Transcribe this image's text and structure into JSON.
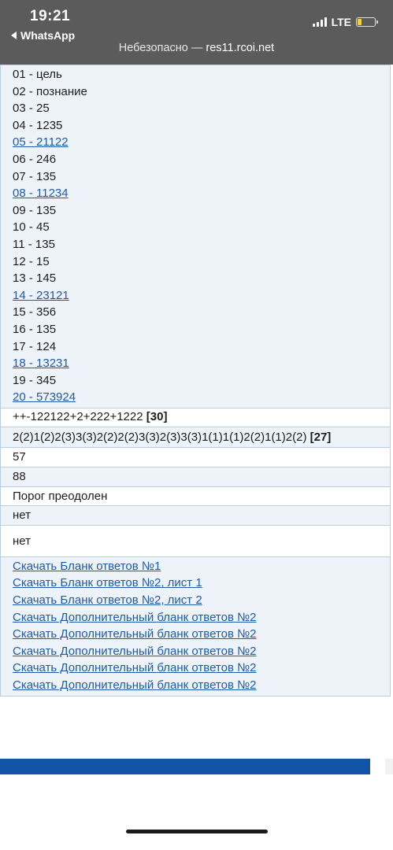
{
  "status_bar": {
    "time": "19:21",
    "back_app": "WhatsApp",
    "network": "LTE"
  },
  "browser": {
    "security_label": "Небезопасно —",
    "domain": "res11.rcoi.net"
  },
  "answers": [
    {
      "text": "01 - цель",
      "link": false
    },
    {
      "text": "02 - познание",
      "link": false
    },
    {
      "text": "03 - 25",
      "link": false
    },
    {
      "text": "04 - 1235",
      "link": false
    },
    {
      "text": "05 - 21122",
      "link": true
    },
    {
      "text": "06 - 246",
      "link": false
    },
    {
      "text": "07 - 135",
      "link": false
    },
    {
      "text": "08 - 11234",
      "link": true
    },
    {
      "text": "09 - 135",
      "link": false
    },
    {
      "text": "10 - 45",
      "link": false
    },
    {
      "text": "11 - 135",
      "link": false
    },
    {
      "text": "12 - 15",
      "link": false
    },
    {
      "text": "13 - 145",
      "link": false
    },
    {
      "text": "14 - 23121",
      "link": true
    },
    {
      "text": "15 - 356",
      "link": false
    },
    {
      "text": "16 - 135",
      "link": false
    },
    {
      "text": "17 - 124",
      "link": false
    },
    {
      "text": "18 - 13231",
      "link": true
    },
    {
      "text": "19 - 345",
      "link": false
    },
    {
      "text": "20 - 573924",
      "link": true
    }
  ],
  "part1_result": {
    "text": "++-122122+2+222+1222",
    "score": "[30]"
  },
  "part2_result": {
    "text": "2(2)1(2)2(3)3(3)2(2)2(2)3(3)2(3)3(3)1(1)1(1)2(2)1(1)2(2)",
    "score": "[27]"
  },
  "primary_score": "57",
  "test_score": "88",
  "threshold_status": "Порог преодолен",
  "appeal_1": "нет",
  "appeal_2": "нет",
  "downloads": [
    "Скачать Бланк ответов №1",
    "Скачать Бланк ответов №2, лист 1",
    "Скачать Бланк ответов №2, лист 2",
    "Скачать Дополнительный бланк ответов №2",
    "Скачать Дополнительный бланк ответов №2",
    "Скачать Дополнительный бланк ответов №2",
    "Скачать Дополнительный бланк ответов №2",
    "Скачать Дополнительный бланк ответов №2"
  ],
  "colors": {
    "link": "#1e5aa8",
    "header_bg": "#5b5b5b",
    "table_bg": "#eef3fa",
    "bar": "#1254a6"
  }
}
